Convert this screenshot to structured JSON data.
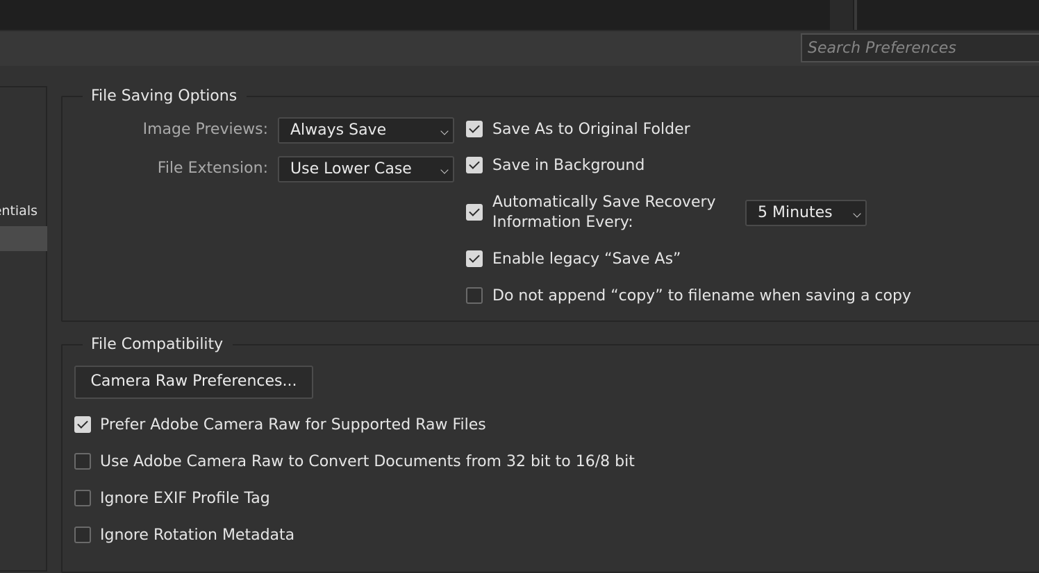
{
  "search": {
    "placeholder": "Search Preferences"
  },
  "sidebar": {
    "items": [
      {
        "label": "entials"
      },
      {
        "label": ""
      }
    ]
  },
  "file_saving": {
    "title": "File Saving Options",
    "image_previews": {
      "label": "Image Previews:",
      "value": "Always Save"
    },
    "file_extension": {
      "label": "File Extension:",
      "value": "Use Lower Case"
    },
    "options": [
      {
        "label": "Save As to Original Folder",
        "checked": true
      },
      {
        "label": "Save in Background",
        "checked": true
      },
      {
        "label_line1": "Automatically Save Recovery",
        "label_line2": "Information Every:",
        "checked": true
      },
      {
        "label": "Enable legacy “Save As”",
        "checked": true
      },
      {
        "label": "Do not append “copy” to filename when saving a copy",
        "checked": false
      }
    ],
    "recovery_interval": {
      "value": "5 Minutes"
    }
  },
  "file_compat": {
    "title": "File Compatibility",
    "camera_raw_button": "Camera Raw Preferences...",
    "options": [
      {
        "label": "Prefer Adobe Camera Raw for Supported Raw Files",
        "checked": true
      },
      {
        "label": "Use Adobe Camera Raw to Convert Documents from 32 bit to 16/8 bit",
        "checked": false
      },
      {
        "label": "Ignore EXIF Profile Tag",
        "checked": false
      },
      {
        "label": "Ignore Rotation Metadata",
        "checked": false
      }
    ]
  },
  "colors": {
    "background": "#323232",
    "topbar": "#1f1f1f",
    "header": "#383838",
    "sidebar_selected": "#4b4b4b",
    "checkbox_on": "#d9d9d9"
  }
}
